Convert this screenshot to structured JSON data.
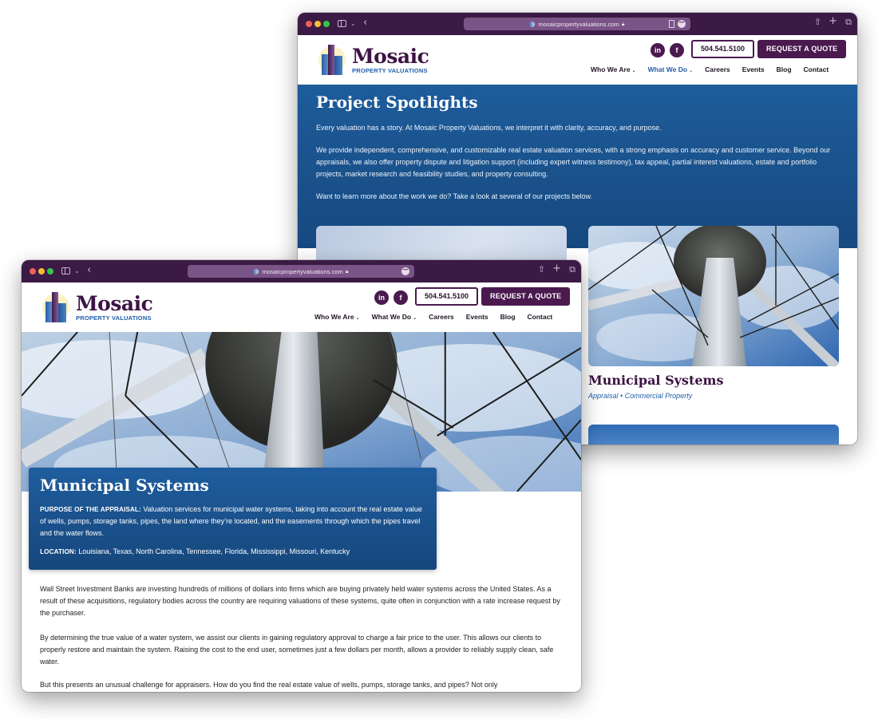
{
  "browser": {
    "url": "mosaicpropertyvaluations.com",
    "icons": [
      "sidebar-toggle-icon",
      "chevron-down-icon",
      "back-arrow-icon",
      "lock-icon",
      "reader-icon",
      "more-icon",
      "share-icon",
      "new-tab-icon",
      "tabs-overview-icon"
    ]
  },
  "site": {
    "logo_name": "Mosaic",
    "logo_sub": "PROPERTY VALUATIONS",
    "social": {
      "linkedin": "in",
      "facebook": "f"
    },
    "phone": "504.541.5100",
    "quote_button": "REQUEST A QUOTE",
    "nav": [
      {
        "label": "Who We Are",
        "caret": "⌄"
      },
      {
        "label": "What We Do",
        "caret": "⌄"
      },
      {
        "label": "Careers"
      },
      {
        "label": "Events"
      },
      {
        "label": "Blog"
      },
      {
        "label": "Contact"
      }
    ],
    "colors": {
      "brand_purple": "#4a1a4f",
      "brand_blue": "#1f5ea8",
      "hero_blue": "#1a5591"
    }
  },
  "back_window": {
    "active_nav": "What We Do",
    "title": "Project Spotlights",
    "paragraphs": [
      "Every valuation has a story. At Mosaic Property Valuations, we interpret it with clarity, accuracy, and purpose.",
      "We provide independent, comprehensive, and customizable real estate valuation services, with a strong emphasis on accuracy and customer service. Beyond our appraisals, we also offer property dispute and litigation support (including expert witness testimony), tax appeal, partial interest valuations, estate and portfolio projects, market research and feasibility studies, and property consulting.",
      "Want to learn more about the work we do? Take a look at several of our projects below."
    ],
    "card": {
      "title": "Municipal Systems",
      "tags": "Appraisal • Commercial Property"
    }
  },
  "front_window": {
    "info": {
      "title": "Municipal Systems",
      "purpose_label": "PURPOSE OF THE APPRAISAL:",
      "purpose_text": " Valuation services for municipal water systems, taking into account the real estate value of wells, pumps, storage tanks, pipes, the land where they’re located, and the easements through which the pipes travel and the water flows.",
      "location_label": "LOCATION:",
      "location_text": " Louisiana, Texas, North Carolina, Tennessee, Florida, Mississippi, Missouri, Kentucky"
    },
    "body": [
      "Wall Street Investment Banks are investing hundreds of millions of dollars into firms which are buying privately held water systems across the United States. As a result of these acquisitions, regulatory bodies across the country are requiring valuations of these systems, quite often in conjunction with a rate increase request by the purchaser.",
      "By determining the true value of a water system, we assist our clients in gaining regulatory approval to charge a fair price to the user. This allows our clients to properly restore and maintain the system. Raising the cost to the end user, sometimes just a few dollars per month, allows a provider to reliably supply clean, safe water.",
      "But this presents an unusual challenge for appraisers. How do you find the real estate value of wells, pumps, storage tanks, and pipes? Not only"
    ]
  }
}
